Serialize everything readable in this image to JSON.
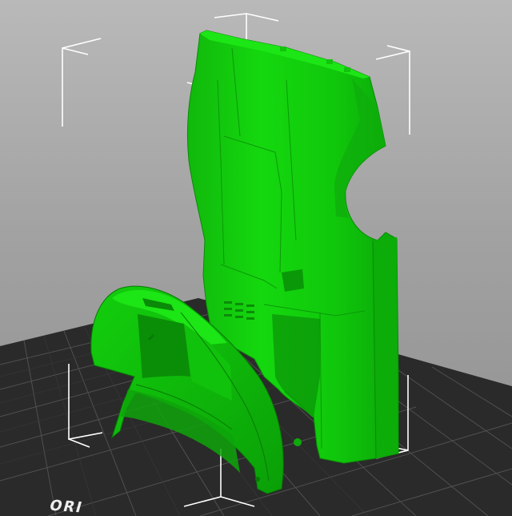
{
  "viewport": {
    "origin_label": "ORI",
    "model_color": "#0fd20a",
    "bed_color": "#2b2b2b",
    "grid_color": "#4f4f4f",
    "bounding_box_color": "#ffffff",
    "background_color": "#a6a6a6"
  },
  "objects": [
    {
      "name": "tall-body-part",
      "color": "#0fd20a"
    },
    {
      "name": "front-fender-part",
      "color": "#0fd20a"
    }
  ]
}
